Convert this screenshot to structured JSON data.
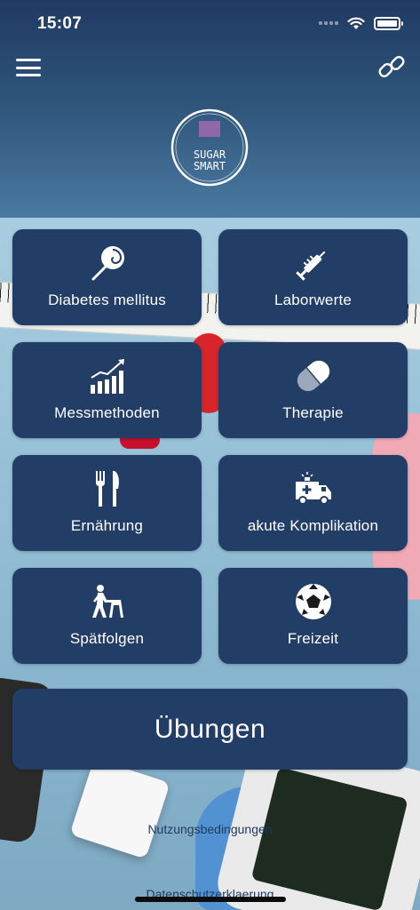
{
  "status_bar": {
    "time": "15:07"
  },
  "header": {
    "menu_icon": "hamburger-menu-icon",
    "link_icon": "chain-link-icon",
    "logo": {
      "line1": "SUGAR",
      "line2": "SMART"
    }
  },
  "tiles": [
    {
      "label": "Diabetes mellitus",
      "icon": "lollipop-icon"
    },
    {
      "label": "Laborwerte",
      "icon": "syringe-icon"
    },
    {
      "label": "Messmethoden",
      "icon": "bar-chart-trend-icon"
    },
    {
      "label": "Therapie",
      "icon": "capsule-pill-icon"
    },
    {
      "label": "Ernährung",
      "icon": "fork-knife-icon"
    },
    {
      "label": "akute Komplikation",
      "icon": "ambulance-icon"
    },
    {
      "label": "Spätfolgen",
      "icon": "elderly-walker-icon"
    },
    {
      "label": "Freizeit",
      "icon": "soccer-ball-icon"
    }
  ],
  "exercises_button": {
    "label": "Übungen"
  },
  "footer": {
    "terms": "Nutzungsbedingungen",
    "privacy": "Datenschutzerklaerung"
  },
  "colors": {
    "tile_bg": "#233e66",
    "header_top": "#1f3a63",
    "header_bottom": "#4a7aa1",
    "footer_link": "#1f3a63"
  }
}
